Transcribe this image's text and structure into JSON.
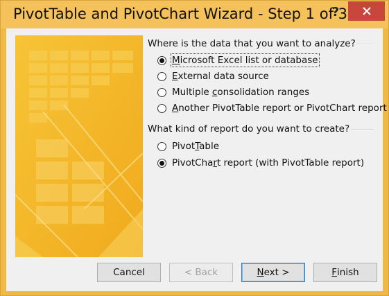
{
  "window": {
    "title": "PivotTable and PivotChart Wizard - Step 1 of 3",
    "help_glyph": "?",
    "close_icon": "close-icon"
  },
  "colors": {
    "title_bar": "#f5c15a",
    "close_button": "#c9463d",
    "banner": "#f2b526",
    "dialog_body": "#f0f0f0"
  },
  "question1": {
    "label": "Where is the data that you want to analyze?",
    "options": [
      {
        "pre": "",
        "key": "M",
        "post": "icrosoft Excel list or database",
        "checked": true
      },
      {
        "pre": "",
        "key": "E",
        "post": "xternal data source",
        "checked": false
      },
      {
        "pre": "Multiple ",
        "key": "c",
        "post": "onsolidation ranges",
        "checked": false
      },
      {
        "pre": "",
        "key": "A",
        "post": "nother PivotTable report or PivotChart report",
        "checked": false
      }
    ]
  },
  "question2": {
    "label": "What kind of report do you want to create?",
    "options": [
      {
        "pre": "Pivot",
        "key": "T",
        "post": "able",
        "checked": false
      },
      {
        "pre": "PivotCha",
        "key": "r",
        "post": "t report (with PivotTable report)",
        "checked": true
      }
    ]
  },
  "buttons": {
    "cancel": "Cancel",
    "back": "< Back",
    "next_key": "N",
    "next_rest": "ext >",
    "finish_key": "F",
    "finish_rest": "inish"
  }
}
